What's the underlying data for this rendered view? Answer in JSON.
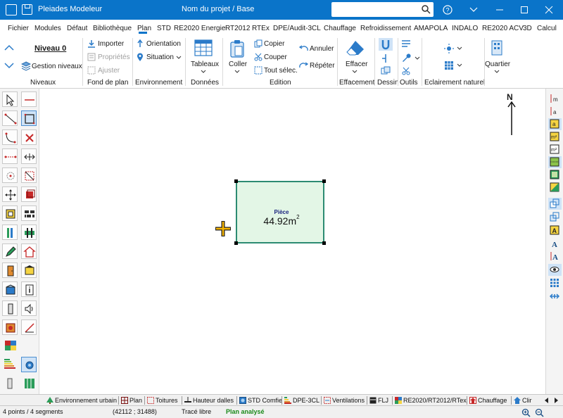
{
  "window": {
    "app_title": "Pleiades Modeleur",
    "project_title": "Nom du projet / Base",
    "search_placeholder": ""
  },
  "menu": [
    "Fichier",
    "Modules",
    "Défaut",
    "Bibliothèque",
    "Plan",
    "STD",
    "RE2020 Energie",
    "RT2012",
    "RTEx",
    "DPE/Audit-3CL",
    "Chauffage",
    "Refroidissement",
    "AMAPOLA",
    "INDALO",
    "RE2020 ACV",
    "3D",
    "Calcul"
  ],
  "menu_active": "Plan",
  "ribbon": {
    "niveaux": {
      "current": "Niveau 0",
      "gestion": "Gestion niveaux",
      "label": "Niveaux"
    },
    "fond": {
      "importer": "Importer",
      "proprietes": "Propriétés",
      "ajuster": "Ajuster",
      "label": "Fond de plan"
    },
    "environnement": {
      "orientation": "Orientation",
      "situation": "Situation",
      "label": "Environnement"
    },
    "donnees": {
      "tableaux": "Tableaux",
      "label": "Données"
    },
    "edition": {
      "coller": "Coller",
      "copier": "Copier",
      "couper": "Couper",
      "tout": "Tout sélec.",
      "annuler": "Annuler",
      "repeter": "Répéter",
      "label": "Edition"
    },
    "effacement": {
      "effacer": "Effacer",
      "label": "Effacement"
    },
    "dessin": {
      "label": "Dessin"
    },
    "outils": {
      "label": "Outils"
    },
    "eclairement": {
      "label": "Eclairement naturel"
    },
    "quartier": {
      "quartier": "Quartier"
    }
  },
  "canvas": {
    "north": "N",
    "room": {
      "name": "Pièce",
      "area": "44.92m",
      "area_unit_sup": "2"
    }
  },
  "tabs": [
    {
      "label": "Environnement urbain",
      "icon": "tree-icon"
    },
    {
      "label": "Plan",
      "icon": "plan-icon"
    },
    {
      "label": "Toitures",
      "icon": "roof-icon"
    },
    {
      "label": "Hauteur dalles",
      "icon": "slab-icon"
    },
    {
      "label": "STD Comfie",
      "icon": "std-icon"
    },
    {
      "label": "DPE-3CL",
      "icon": "dpe-icon"
    },
    {
      "label": "Ventilations",
      "icon": "ventilation-icon"
    },
    {
      "label": "FLJ",
      "icon": "flj-icon"
    },
    {
      "label": "RE2020/RT2012/RTex",
      "icon": "re2020-icon"
    },
    {
      "label": "Chauffage",
      "icon": "heating-icon"
    },
    {
      "label": "Clir",
      "icon": "house-icon"
    }
  ],
  "status": {
    "segments": "4 points / 4 segments",
    "coords": "(42112 ; 31488)",
    "mode": "Tracé libre",
    "state": "Plan analysé"
  },
  "colors": {
    "accent": "#0a74c9",
    "room_fill": "#e3f6e6",
    "room_border": "#2c8b72",
    "status_ok": "#1a8a1a"
  }
}
